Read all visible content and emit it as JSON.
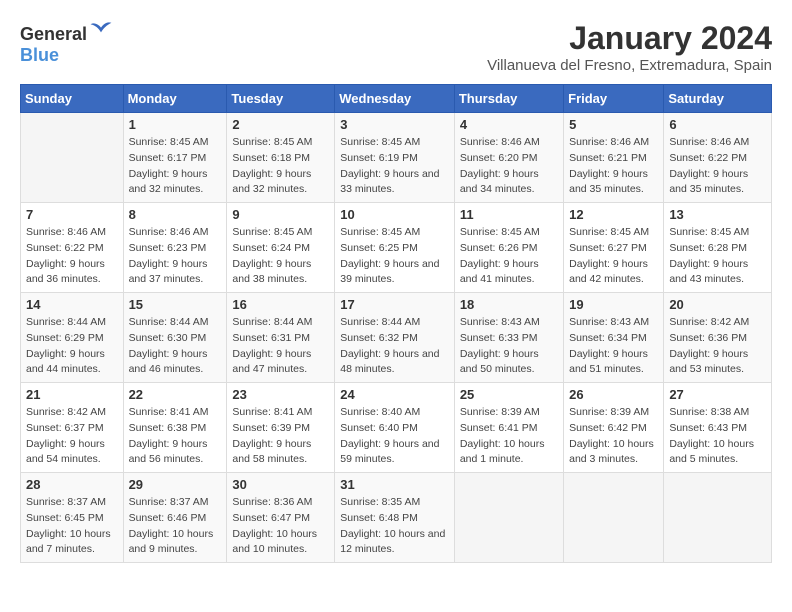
{
  "logo": {
    "text_general": "General",
    "text_blue": "Blue"
  },
  "title": "January 2024",
  "subtitle": "Villanueva del Fresno, Extremadura, Spain",
  "days_of_week": [
    "Sunday",
    "Monday",
    "Tuesday",
    "Wednesday",
    "Thursday",
    "Friday",
    "Saturday"
  ],
  "weeks": [
    [
      {
        "day": "",
        "sunrise": "",
        "sunset": "",
        "daylight": ""
      },
      {
        "day": "1",
        "sunrise": "Sunrise: 8:45 AM",
        "sunset": "Sunset: 6:17 PM",
        "daylight": "Daylight: 9 hours and 32 minutes."
      },
      {
        "day": "2",
        "sunrise": "Sunrise: 8:45 AM",
        "sunset": "Sunset: 6:18 PM",
        "daylight": "Daylight: 9 hours and 32 minutes."
      },
      {
        "day": "3",
        "sunrise": "Sunrise: 8:45 AM",
        "sunset": "Sunset: 6:19 PM",
        "daylight": "Daylight: 9 hours and 33 minutes."
      },
      {
        "day": "4",
        "sunrise": "Sunrise: 8:46 AM",
        "sunset": "Sunset: 6:20 PM",
        "daylight": "Daylight: 9 hours and 34 minutes."
      },
      {
        "day": "5",
        "sunrise": "Sunrise: 8:46 AM",
        "sunset": "Sunset: 6:21 PM",
        "daylight": "Daylight: 9 hours and 35 minutes."
      },
      {
        "day": "6",
        "sunrise": "Sunrise: 8:46 AM",
        "sunset": "Sunset: 6:22 PM",
        "daylight": "Daylight: 9 hours and 35 minutes."
      }
    ],
    [
      {
        "day": "7",
        "sunrise": "Sunrise: 8:46 AM",
        "sunset": "Sunset: 6:22 PM",
        "daylight": "Daylight: 9 hours and 36 minutes."
      },
      {
        "day": "8",
        "sunrise": "Sunrise: 8:46 AM",
        "sunset": "Sunset: 6:23 PM",
        "daylight": "Daylight: 9 hours and 37 minutes."
      },
      {
        "day": "9",
        "sunrise": "Sunrise: 8:45 AM",
        "sunset": "Sunset: 6:24 PM",
        "daylight": "Daylight: 9 hours and 38 minutes."
      },
      {
        "day": "10",
        "sunrise": "Sunrise: 8:45 AM",
        "sunset": "Sunset: 6:25 PM",
        "daylight": "Daylight: 9 hours and 39 minutes."
      },
      {
        "day": "11",
        "sunrise": "Sunrise: 8:45 AM",
        "sunset": "Sunset: 6:26 PM",
        "daylight": "Daylight: 9 hours and 41 minutes."
      },
      {
        "day": "12",
        "sunrise": "Sunrise: 8:45 AM",
        "sunset": "Sunset: 6:27 PM",
        "daylight": "Daylight: 9 hours and 42 minutes."
      },
      {
        "day": "13",
        "sunrise": "Sunrise: 8:45 AM",
        "sunset": "Sunset: 6:28 PM",
        "daylight": "Daylight: 9 hours and 43 minutes."
      }
    ],
    [
      {
        "day": "14",
        "sunrise": "Sunrise: 8:44 AM",
        "sunset": "Sunset: 6:29 PM",
        "daylight": "Daylight: 9 hours and 44 minutes."
      },
      {
        "day": "15",
        "sunrise": "Sunrise: 8:44 AM",
        "sunset": "Sunset: 6:30 PM",
        "daylight": "Daylight: 9 hours and 46 minutes."
      },
      {
        "day": "16",
        "sunrise": "Sunrise: 8:44 AM",
        "sunset": "Sunset: 6:31 PM",
        "daylight": "Daylight: 9 hours and 47 minutes."
      },
      {
        "day": "17",
        "sunrise": "Sunrise: 8:44 AM",
        "sunset": "Sunset: 6:32 PM",
        "daylight": "Daylight: 9 hours and 48 minutes."
      },
      {
        "day": "18",
        "sunrise": "Sunrise: 8:43 AM",
        "sunset": "Sunset: 6:33 PM",
        "daylight": "Daylight: 9 hours and 50 minutes."
      },
      {
        "day": "19",
        "sunrise": "Sunrise: 8:43 AM",
        "sunset": "Sunset: 6:34 PM",
        "daylight": "Daylight: 9 hours and 51 minutes."
      },
      {
        "day": "20",
        "sunrise": "Sunrise: 8:42 AM",
        "sunset": "Sunset: 6:36 PM",
        "daylight": "Daylight: 9 hours and 53 minutes."
      }
    ],
    [
      {
        "day": "21",
        "sunrise": "Sunrise: 8:42 AM",
        "sunset": "Sunset: 6:37 PM",
        "daylight": "Daylight: 9 hours and 54 minutes."
      },
      {
        "day": "22",
        "sunrise": "Sunrise: 8:41 AM",
        "sunset": "Sunset: 6:38 PM",
        "daylight": "Daylight: 9 hours and 56 minutes."
      },
      {
        "day": "23",
        "sunrise": "Sunrise: 8:41 AM",
        "sunset": "Sunset: 6:39 PM",
        "daylight": "Daylight: 9 hours and 58 minutes."
      },
      {
        "day": "24",
        "sunrise": "Sunrise: 8:40 AM",
        "sunset": "Sunset: 6:40 PM",
        "daylight": "Daylight: 9 hours and 59 minutes."
      },
      {
        "day": "25",
        "sunrise": "Sunrise: 8:39 AM",
        "sunset": "Sunset: 6:41 PM",
        "daylight": "Daylight: 10 hours and 1 minute."
      },
      {
        "day": "26",
        "sunrise": "Sunrise: 8:39 AM",
        "sunset": "Sunset: 6:42 PM",
        "daylight": "Daylight: 10 hours and 3 minutes."
      },
      {
        "day": "27",
        "sunrise": "Sunrise: 8:38 AM",
        "sunset": "Sunset: 6:43 PM",
        "daylight": "Daylight: 10 hours and 5 minutes."
      }
    ],
    [
      {
        "day": "28",
        "sunrise": "Sunrise: 8:37 AM",
        "sunset": "Sunset: 6:45 PM",
        "daylight": "Daylight: 10 hours and 7 minutes."
      },
      {
        "day": "29",
        "sunrise": "Sunrise: 8:37 AM",
        "sunset": "Sunset: 6:46 PM",
        "daylight": "Daylight: 10 hours and 9 minutes."
      },
      {
        "day": "30",
        "sunrise": "Sunrise: 8:36 AM",
        "sunset": "Sunset: 6:47 PM",
        "daylight": "Daylight: 10 hours and 10 minutes."
      },
      {
        "day": "31",
        "sunrise": "Sunrise: 8:35 AM",
        "sunset": "Sunset: 6:48 PM",
        "daylight": "Daylight: 10 hours and 12 minutes."
      },
      {
        "day": "",
        "sunrise": "",
        "sunset": "",
        "daylight": ""
      },
      {
        "day": "",
        "sunrise": "",
        "sunset": "",
        "daylight": ""
      },
      {
        "day": "",
        "sunrise": "",
        "sunset": "",
        "daylight": ""
      }
    ]
  ]
}
